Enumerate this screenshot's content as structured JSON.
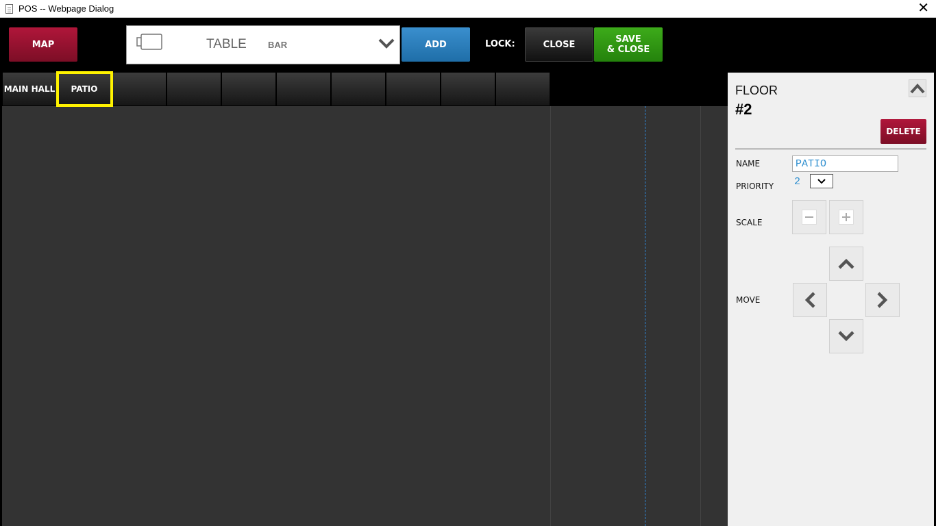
{
  "window": {
    "title": "POS -- Webpage Dialog",
    "close_glyph": "✕"
  },
  "toolbar": {
    "map_label": "MAP",
    "selector": {
      "selected": "TABLE",
      "other_option": "BAR"
    },
    "add_label": "ADD",
    "lock_label": "LOCK:",
    "close_label": "CLOSE",
    "save_line1": "SAVE",
    "save_line2": "& CLOSE"
  },
  "tabs": [
    {
      "label": "MAIN HALL"
    },
    {
      "label": "PATIO",
      "highlighted": true
    },
    {
      "label": ""
    },
    {
      "label": ""
    },
    {
      "label": ""
    },
    {
      "label": ""
    },
    {
      "label": ""
    },
    {
      "label": ""
    },
    {
      "label": ""
    },
    {
      "label": ""
    }
  ],
  "panel": {
    "floor_label": "FLOOR",
    "floor_number": "#2",
    "delete_label": "DELETE",
    "name_label": "NAME",
    "name_value": "PATIO",
    "priority_label": "PRIORITY",
    "priority_value": "2",
    "scale_label": "SCALE",
    "move_label": "MOVE"
  },
  "colors": {
    "map": "#9a1230",
    "add": "#2a80c0",
    "save": "#2f9a14",
    "delete": "#9a1230",
    "highlight": "#fff200",
    "canvas": "#333333",
    "panel": "#f0f0f0"
  },
  "icons": [
    "table-shape-icon",
    "chevron-down-icon",
    "chevron-up-icon",
    "minus-icon",
    "plus-icon",
    "arrow-up-icon",
    "arrow-left-icon",
    "arrow-right-icon",
    "arrow-down-icon"
  ]
}
